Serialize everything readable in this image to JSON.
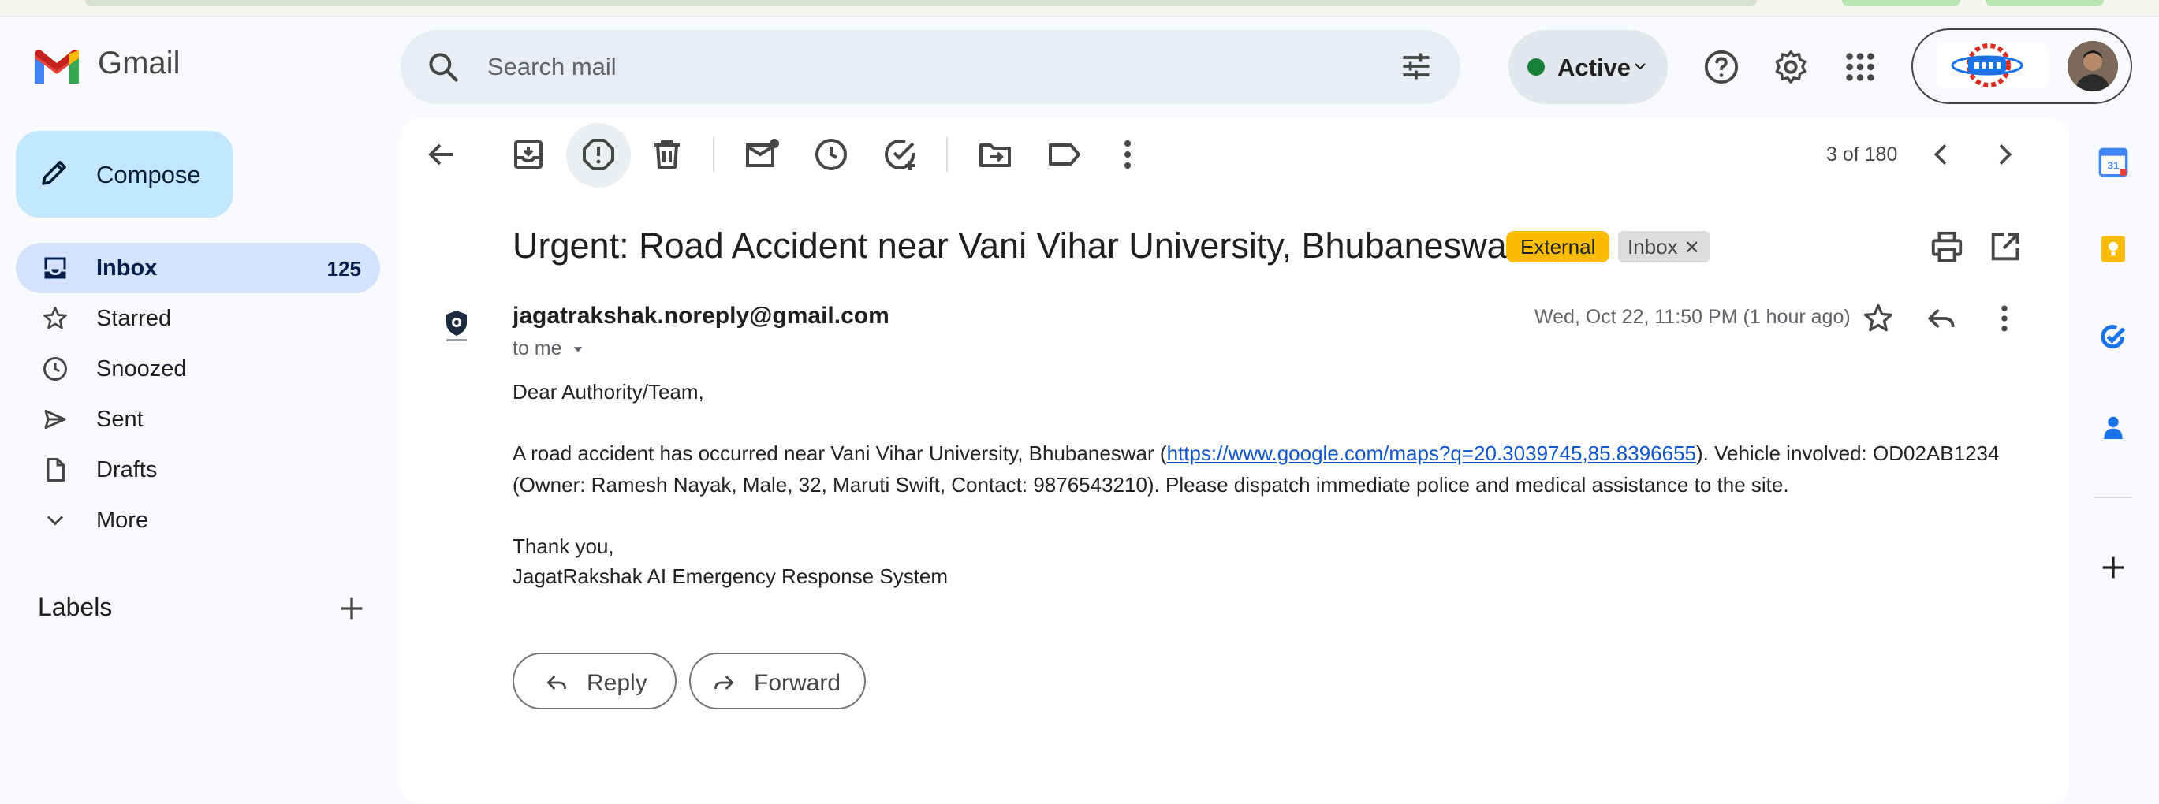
{
  "app": {
    "name": "Gmail"
  },
  "header": {
    "search_placeholder": "Search mail",
    "status_label": "Active"
  },
  "sidebar": {
    "compose_label": "Compose",
    "items": [
      {
        "label": "Inbox",
        "count": "125",
        "icon": "inbox-icon",
        "active": true
      },
      {
        "label": "Starred",
        "icon": "star-icon"
      },
      {
        "label": "Snoozed",
        "icon": "clock-icon"
      },
      {
        "label": "Sent",
        "icon": "send-icon"
      },
      {
        "label": "Drafts",
        "icon": "draft-icon"
      },
      {
        "label": "More",
        "icon": "chevron-down-icon"
      }
    ],
    "labels_title": "Labels"
  },
  "toolbar": {
    "pager": "3 of 180"
  },
  "email": {
    "subject": "Urgent: Road Accident near Vani Vihar University, Bhubaneswar",
    "badge_external": "External",
    "badge_inbox": "Inbox",
    "sender": "jagatrakshak.noreply@gmail.com",
    "to": "to me",
    "date": "Wed, Oct 22, 11:50 PM (1 hour ago)",
    "greeting": "Dear Authority/Team,",
    "line1_before": "A road accident has occurred near Vani Vihar University, Bhubaneswar (",
    "link": "https://www.google.com/maps?q=20.3039745,85.8396655",
    "line1_after": "). Vehicle involved: OD02AB1234",
    "line2": "(Owner: Ramesh Nayak, Male, 32, Maruti Swift, Contact: 9876543210). Please dispatch immediate police and medical assistance to the site.",
    "closing": "Thank you,",
    "signature": "JagatRakshak AI Emergency Response System"
  },
  "actions": {
    "reply_label": "Reply",
    "forward_label": "Forward"
  },
  "colors": {
    "compose_bg": "#c2e7ff",
    "active_nav_bg": "#d3e3fd",
    "external_badge": "#fbbc04",
    "link": "#1155cc",
    "status_dot": "#188038"
  }
}
